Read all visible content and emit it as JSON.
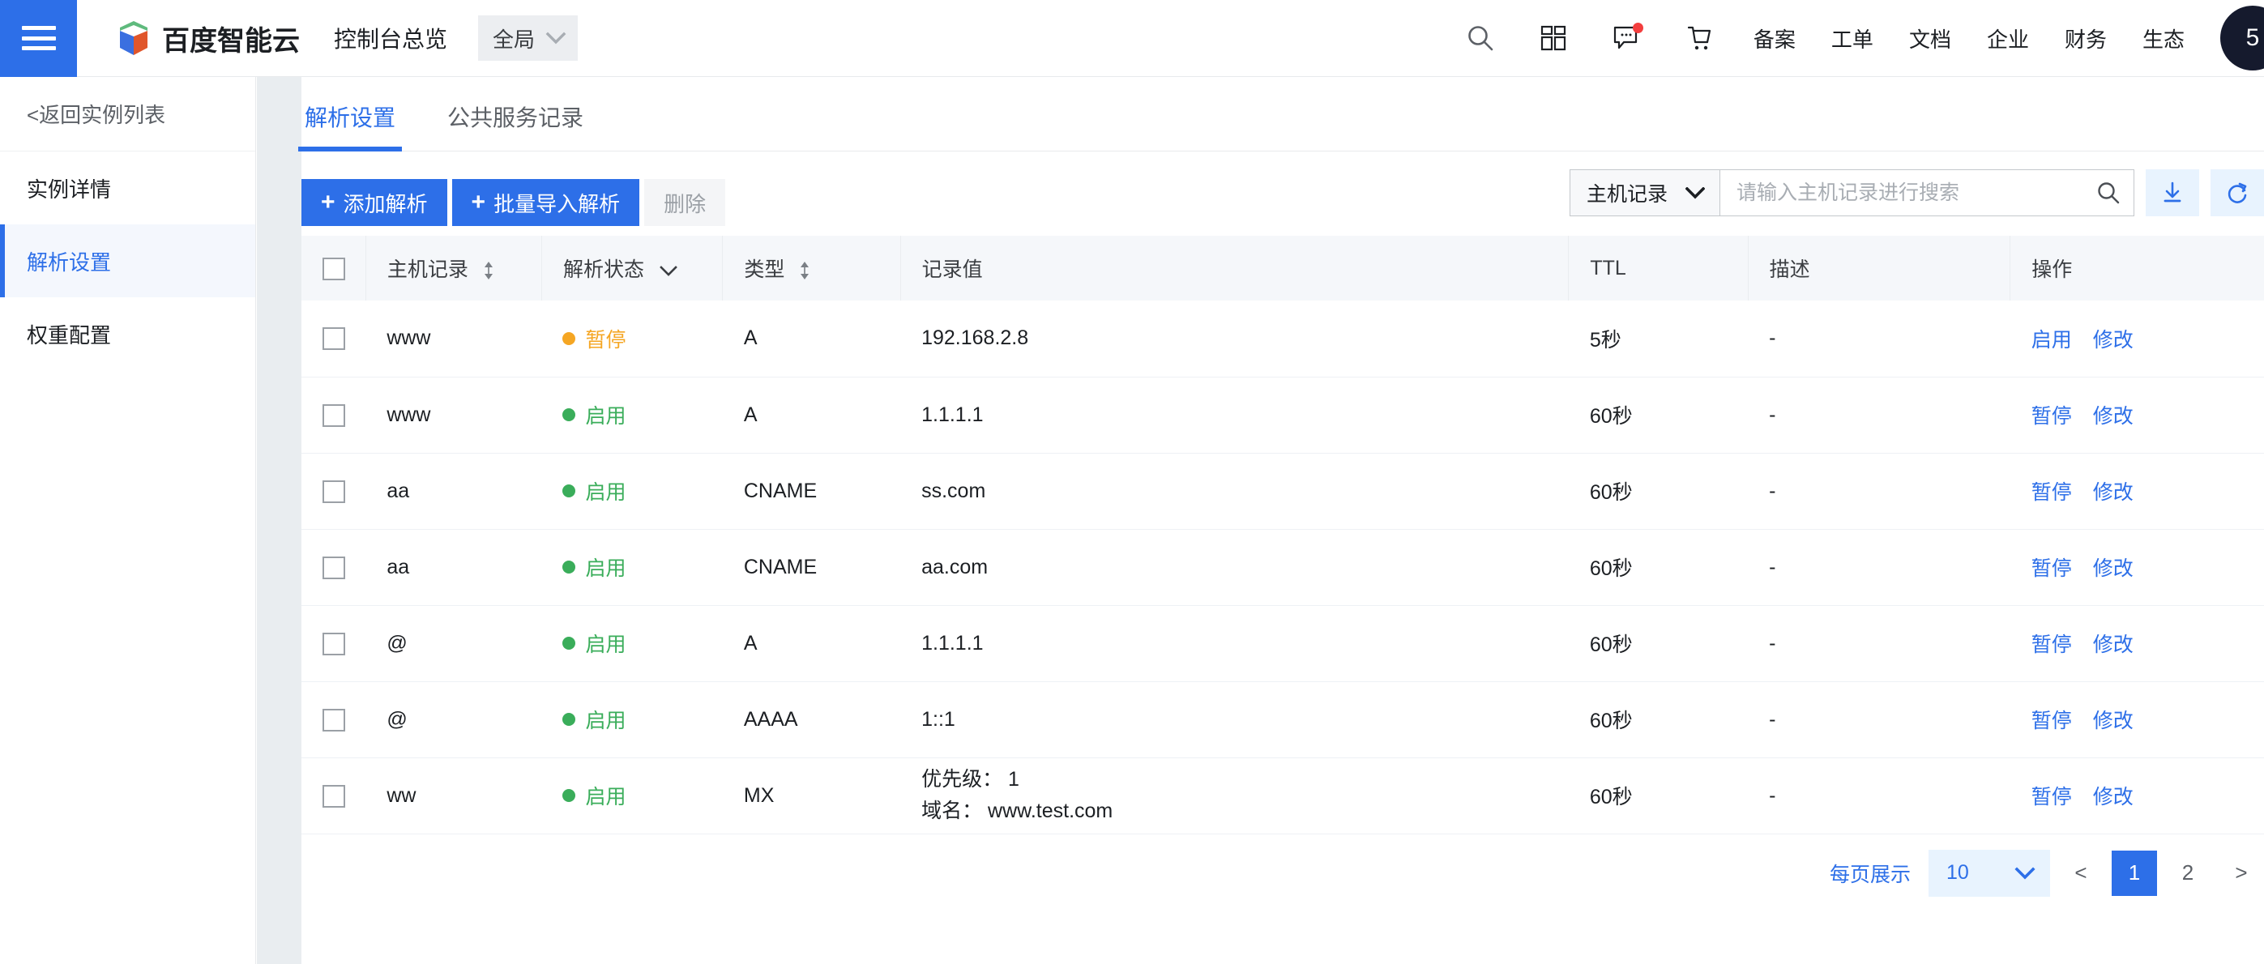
{
  "topbar": {
    "menu_icon": "hamburger-icon",
    "brand_name": "百度智能云",
    "brand_logo": "baidu-cloud-logo",
    "console_title": "控制台总览",
    "region": {
      "label": "全局",
      "chevron": "chevron-down-icon"
    },
    "icons": [
      {
        "name": "search-icon",
        "glyph": "search"
      },
      {
        "name": "apps-grid-icon",
        "glyph": "grid"
      },
      {
        "name": "message-icon",
        "glyph": "message",
        "badge": true
      },
      {
        "name": "cart-icon",
        "glyph": "cart"
      }
    ],
    "links": [
      "备案",
      "工单",
      "文档",
      "企业",
      "财务",
      "生态"
    ],
    "avatar_text": "5"
  },
  "sidebar": {
    "back_label": "<返回实例列表",
    "items": [
      {
        "label": "实例详情",
        "active": false
      },
      {
        "label": "解析设置",
        "active": true
      },
      {
        "label": "权重配置",
        "active": false
      }
    ]
  },
  "tabs": [
    {
      "label": "解析设置",
      "active": true
    },
    {
      "label": "公共服务记录",
      "active": false
    }
  ],
  "toolbar": {
    "add_label": "添加解析",
    "batch_import_label": "批量导入解析",
    "delete_label": "删除",
    "plus_glyph": "+",
    "download_icon": "download-icon",
    "refresh_icon": "refresh-icon"
  },
  "search": {
    "category": "主机记录",
    "category_chevron": "chevron-down-icon",
    "placeholder": "请输入主机记录进行搜索",
    "value": "",
    "search_icon": "search-icon"
  },
  "table": {
    "columns": [
      {
        "key": "check",
        "label": "",
        "sortable": false
      },
      {
        "key": "host",
        "label": "主机记录",
        "sortable": true
      },
      {
        "key": "state",
        "label": "解析状态",
        "filterable": true
      },
      {
        "key": "type",
        "label": "类型",
        "sortable": true
      },
      {
        "key": "value",
        "label": "记录值"
      },
      {
        "key": "ttl",
        "label": "TTL"
      },
      {
        "key": "desc",
        "label": "描述"
      },
      {
        "key": "ops",
        "label": "操作"
      }
    ],
    "rows": [
      {
        "host": "www",
        "state": "暂停",
        "state_kind": "warn",
        "type": "A",
        "value": "192.168.2.8",
        "ttl": "5秒",
        "desc": "-",
        "ops": [
          "启用",
          "修改"
        ]
      },
      {
        "host": "www",
        "state": "启用",
        "state_kind": "ok",
        "type": "A",
        "value": "1.1.1.1",
        "ttl": "60秒",
        "desc": "-",
        "ops": [
          "暂停",
          "修改"
        ]
      },
      {
        "host": "aa",
        "state": "启用",
        "state_kind": "ok",
        "type": "CNAME",
        "value": "ss.com",
        "ttl": "60秒",
        "desc": "-",
        "ops": [
          "暂停",
          "修改"
        ]
      },
      {
        "host": "aa",
        "state": "启用",
        "state_kind": "ok",
        "type": "CNAME",
        "value": "aa.com",
        "ttl": "60秒",
        "desc": "-",
        "ops": [
          "暂停",
          "修改"
        ]
      },
      {
        "host": "@",
        "state": "启用",
        "state_kind": "ok",
        "type": "A",
        "value": "1.1.1.1",
        "ttl": "60秒",
        "desc": "-",
        "ops": [
          "暂停",
          "修改"
        ]
      },
      {
        "host": "@",
        "state": "启用",
        "state_kind": "ok",
        "type": "AAAA",
        "value": "1::1",
        "ttl": "60秒",
        "desc": "-",
        "ops": [
          "暂停",
          "修改"
        ]
      },
      {
        "host": "ww",
        "state": "启用",
        "state_kind": "ok",
        "type": "MX",
        "value_line1": "优先级： 1",
        "value_line2": "域名： www.test.com",
        "ttl": "60秒",
        "desc": "-",
        "ops": [
          "暂停",
          "修改"
        ]
      }
    ]
  },
  "pagination": {
    "per_page_label": "每页展示",
    "page_size": "10",
    "page_size_chevron": "chevron-down-icon",
    "prev": "<",
    "next": ">",
    "pages": [
      "1",
      "2"
    ],
    "current_page": "1"
  },
  "colors": {
    "primary": "#2d6fe8",
    "status_ok": "#3aad5a",
    "status_warn": "#f5a623",
    "header_bg": "#f5f7fa",
    "avatar_bg": "#151a2d"
  }
}
